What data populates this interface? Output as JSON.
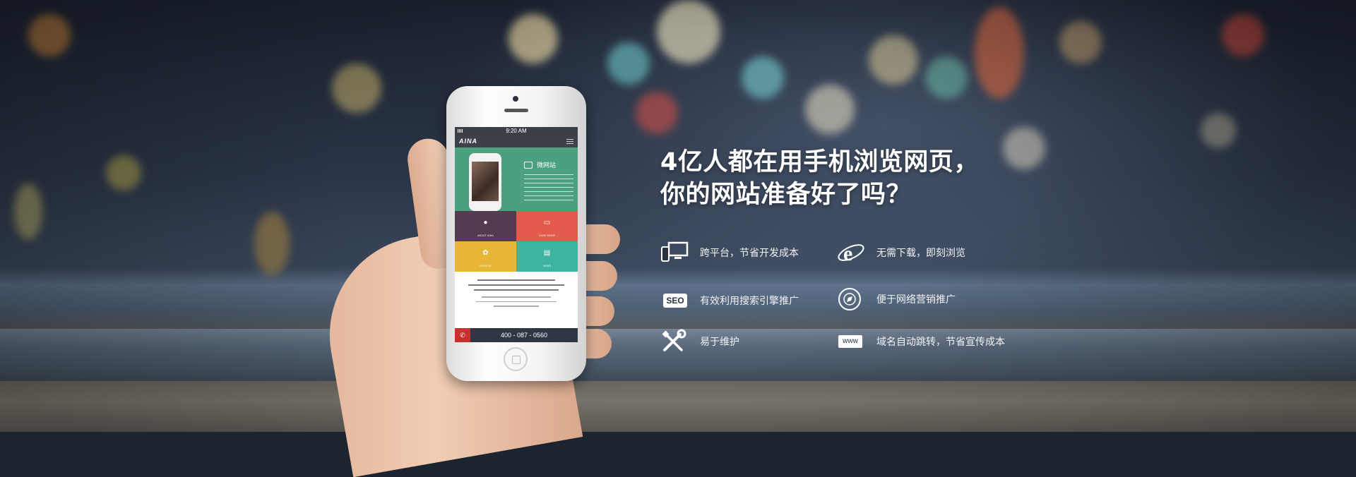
{
  "phone": {
    "status_time": "9:20 AM",
    "logo": "AINA",
    "hero_title": "微网站",
    "tiles": [
      {
        "label": "ABOUT AINA",
        "icon": "lightbulb-icon",
        "color": "#553b50"
      },
      {
        "label": "CASE SHOW",
        "icon": "monitor-icon",
        "color": "#e45a4d"
      },
      {
        "label": "SERVICE",
        "icon": "gear-icon",
        "color": "#e8b636"
      },
      {
        "label": "NEWS",
        "icon": "document-icon",
        "color": "#3db3a2"
      }
    ],
    "call_number": "400 - 087 - 0560"
  },
  "headline": {
    "line1": "4亿人都在用手机浏览网页，",
    "line2": "你的网站准备好了吗？"
  },
  "features": [
    {
      "icon": "devices-icon",
      "label": "跨平台，节省开发成本"
    },
    {
      "icon": "ie-browser-icon",
      "label": "无需下载，即刻浏览"
    },
    {
      "icon": "seo-icon",
      "label": "有效利用搜索引擎推广",
      "icon_text": "SEO"
    },
    {
      "icon": "compass-icon",
      "label": "便于网络营销推广"
    },
    {
      "icon": "tools-icon",
      "label": "易于维护"
    },
    {
      "icon": "www-icon",
      "label": "域名自动跳转，节省宣传成本",
      "icon_text": "www"
    }
  ]
}
